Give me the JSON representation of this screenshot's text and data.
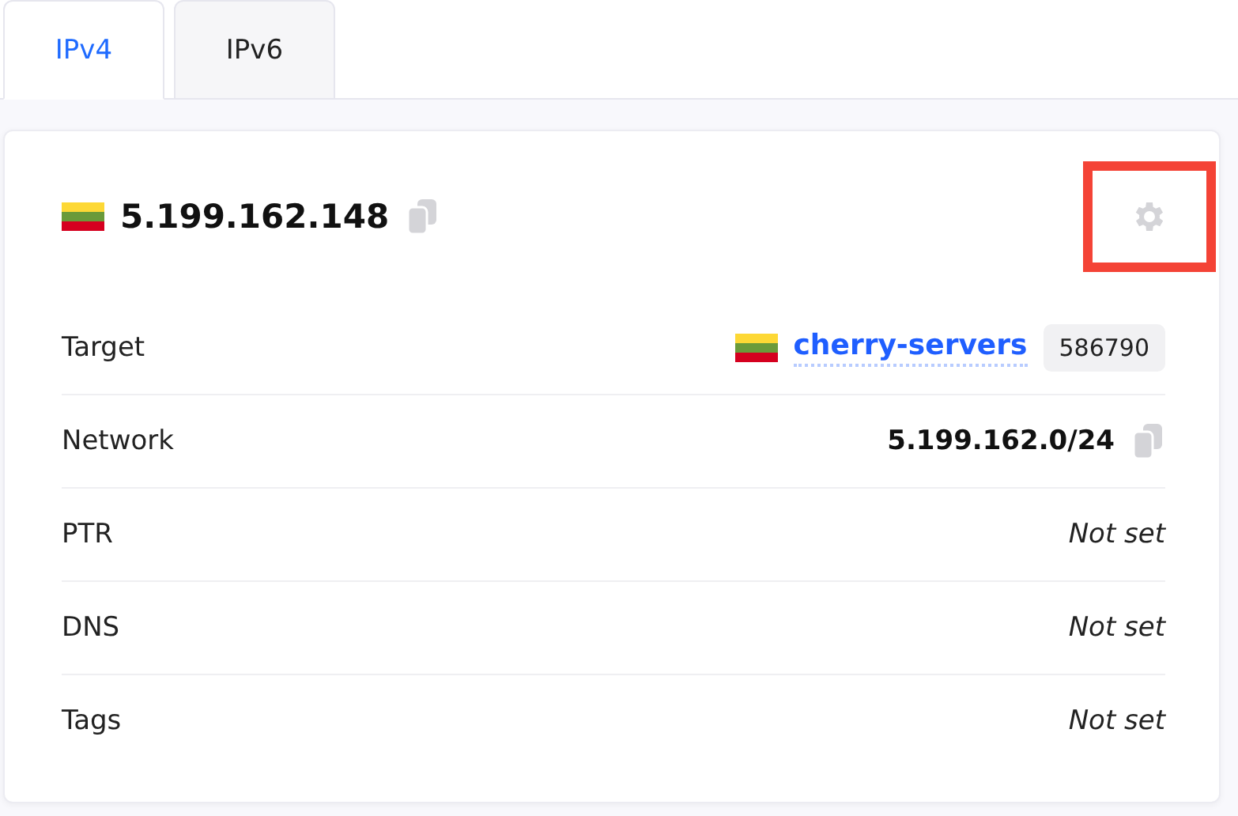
{
  "tabs": [
    {
      "label": "IPv4",
      "selected": true
    },
    {
      "label": "IPv6",
      "selected": false
    }
  ],
  "card": {
    "address": "5.199.162.148",
    "settings_highlighted": true,
    "rows": [
      {
        "kind": "target",
        "label": "Target",
        "value": "cherry-servers",
        "badge": "586790"
      },
      {
        "kind": "network",
        "label": "Network",
        "value": "5.199.162.0/24"
      },
      {
        "kind": "empty",
        "label": "PTR",
        "value": "Not set"
      },
      {
        "kind": "empty",
        "label": "DNS",
        "value": "Not set"
      },
      {
        "kind": "empty",
        "label": "Tags",
        "value": "Not set"
      }
    ]
  }
}
